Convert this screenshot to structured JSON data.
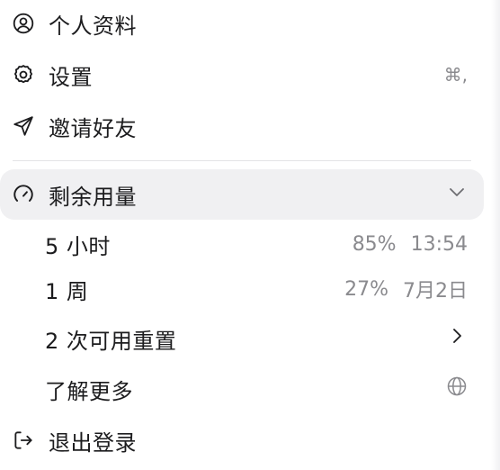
{
  "menu": {
    "profile": {
      "label": "个人资料",
      "icon": "user-circle-icon"
    },
    "settings": {
      "label": "设置",
      "icon": "gear-icon",
      "shortcut": "⌘,"
    },
    "invite": {
      "label": "邀请好友",
      "icon": "send-icon"
    },
    "usage": {
      "label": "剩余用量",
      "icon": "gauge-icon",
      "expanded": true,
      "items": [
        {
          "label": "5 小时",
          "percent": "85%",
          "time": "13:54"
        },
        {
          "label": "1 周",
          "percent": "27%",
          "time": "7月2日"
        }
      ]
    },
    "resets": {
      "label": "2 次可用重置",
      "icon": "chevron-right-icon"
    },
    "learn_more": {
      "label": "了解更多",
      "icon": "globe-icon"
    },
    "logout": {
      "label": "退出登录",
      "icon": "logout-icon"
    }
  },
  "colors": {
    "text": "#1c1c1e",
    "muted": "#8a8a8e",
    "active_bg": "#f0f0f2",
    "divider": "#e3e3e6"
  }
}
